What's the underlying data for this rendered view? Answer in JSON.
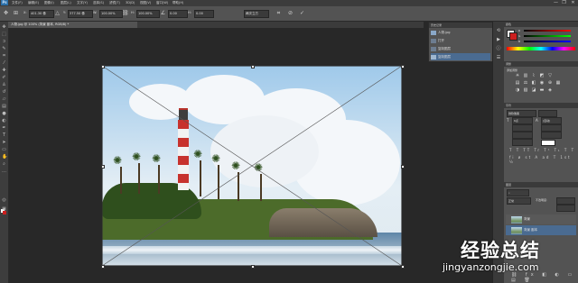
{
  "app": {
    "logo": "Ps",
    "menus": [
      "文件(F)",
      "编辑(E)",
      "图像(I)",
      "图层(L)",
      "文字(Y)",
      "选择(S)",
      "滤镜(T)",
      "3D(D)",
      "视图(V)",
      "窗口(W)",
      "帮助(H)"
    ]
  },
  "window_controls": [
    "—",
    "❐",
    "✕"
  ],
  "options_bar": {
    "x_value": "401.30 像",
    "y_value": "377.50 像",
    "w_value": "100.00%",
    "h_value": "100.00%",
    "angle_value": "0.00",
    "h_skew": "0.00",
    "interp": "两次立方"
  },
  "document_tab": {
    "label": "人物.jpg @ 100% (背景 副本, RGB/8) *"
  },
  "history_panel": {
    "title": "历史记录",
    "items": [
      "人物.jpg",
      "打开",
      "复制图层",
      "复制图层"
    ]
  },
  "color_panel": {
    "title": "颜色",
    "labels": [
      "R",
      "G",
      "B"
    ]
  },
  "adjustments_panel": {
    "title": "调整",
    "subtitle": "添加调整"
  },
  "character_panel": {
    "title": "字符",
    "font": "微软雅黑",
    "size": "6点",
    "leading": "(自动)"
  },
  "layers_panel": {
    "title": "图层",
    "blend_mode": "正常",
    "opacity_label": "不透明度:",
    "layers": [
      {
        "name": "背景"
      },
      {
        "name": "背景 副本"
      }
    ]
  },
  "watermark": {
    "text_cn": "经验总结",
    "url": "jingyanzongjie.com"
  },
  "colors": {
    "foreground": "#ffffff",
    "background": "#cc1f1f",
    "ps_blue": "#2b6fa8"
  }
}
